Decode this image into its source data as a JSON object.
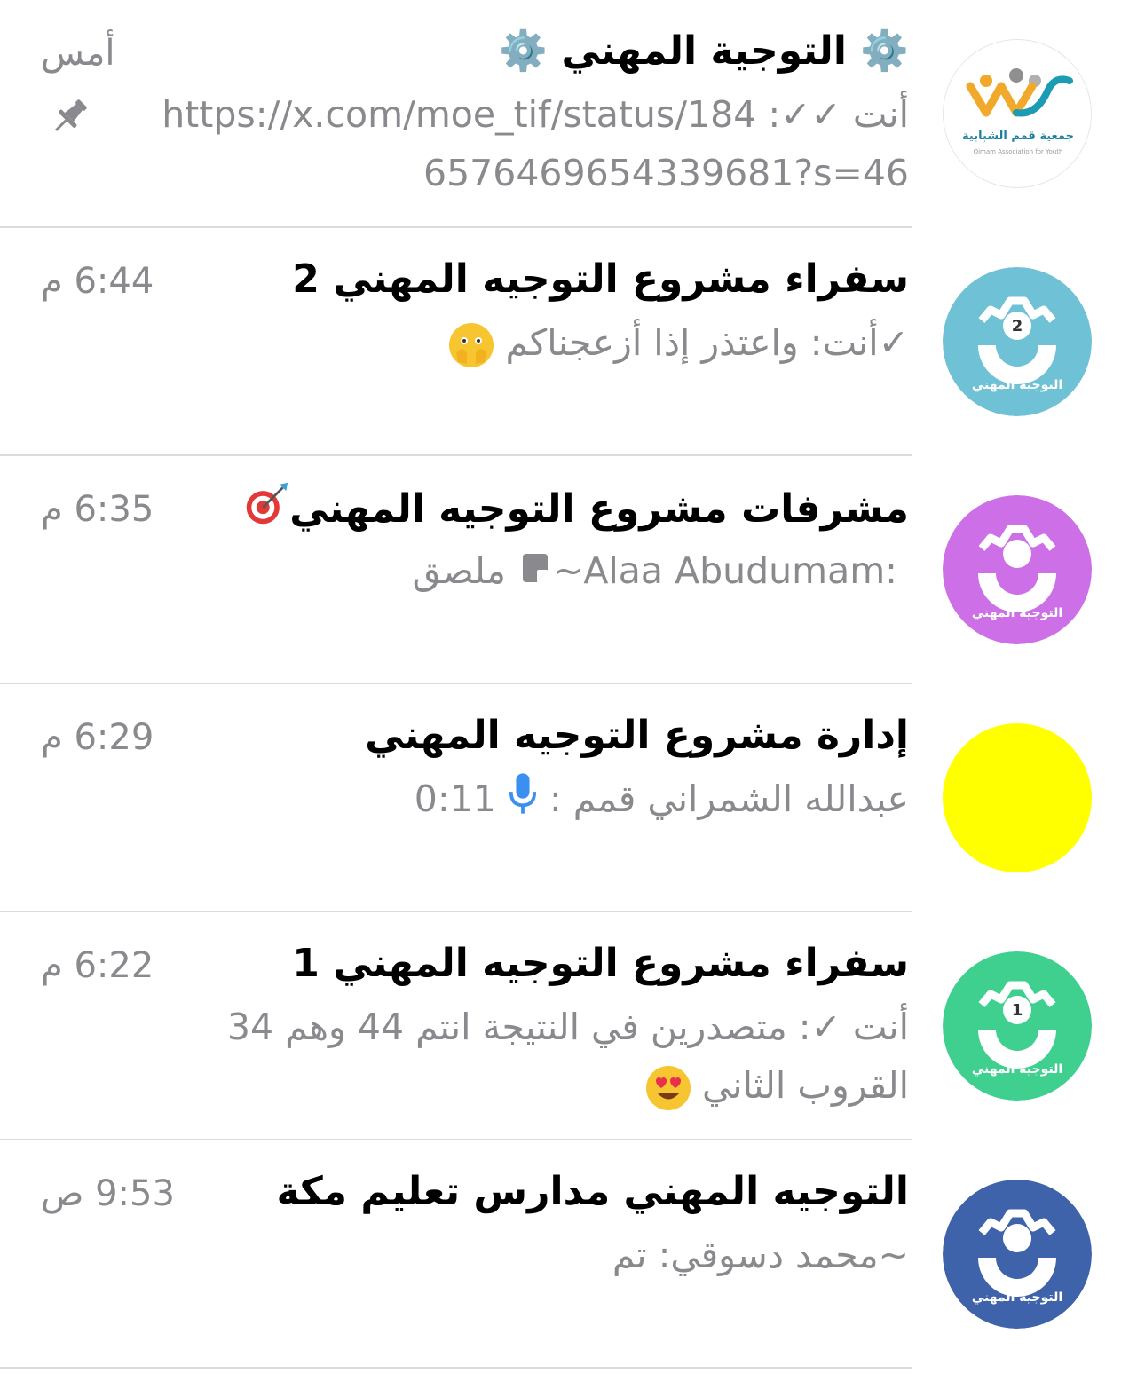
{
  "chats": [
    {
      "title": "⚙️ التوجية المهني ⚙️",
      "time": "أمس",
      "preview_sender": "أنت ✓✓: ",
      "preview_text": "https://x.com/moe_tif/status/1846576469654339681?s=46",
      "pinned": true,
      "avatar": {
        "type": "logo",
        "text_ar": "جمعية قمم الشبابية",
        "text_en": "Qimam Association for Youth"
      }
    },
    {
      "title": "سفراء مشروع التوجيه المهني 2",
      "time": "6:44 م",
      "preview_sender": "✓أنت: ",
      "preview_text": "واعتذر إذا أزعجناكم",
      "preview_emoji": "face-with-open-eyes-and-hand-over-mouth",
      "avatar": {
        "type": "gear",
        "color": "#6fc1d6",
        "badge": "2",
        "label": "التوجيه المهني"
      }
    },
    {
      "title": "مشرفات مشروع التوجيه المهني",
      "title_emoji": "direct-hit",
      "time": "6:35 م",
      "preview_sender": "~Alaa Abudumam: ",
      "preview_text": "ملصق",
      "preview_icon": "sticker-icon",
      "avatar": {
        "type": "gear",
        "color": "#cd6fe6",
        "badge": "",
        "label": "التوجيه المهني"
      }
    },
    {
      "title": "إدارة مشروع التوجيه المهني",
      "time": "6:29 م",
      "preview_sender": "عبدالله الشمراني قمم : ",
      "preview_text": "0:11",
      "preview_icon": "microphone-icon",
      "avatar": {
        "type": "solid",
        "color": "#ffff00"
      }
    },
    {
      "title": "سفراء مشروع التوجيه المهني 1",
      "time": "6:22 م",
      "preview_sender": "أنت ✓: ",
      "preview_text": "متصدرين في النتيجة  انتم 44  وهم 34 القروب الثاني",
      "preview_emoji": "smiling-face-with-heart-eyes",
      "avatar": {
        "type": "gear",
        "color": "#3fcf8e",
        "badge": "1",
        "label": "التوجيه المهني"
      }
    },
    {
      "title": "التوجيه المهني مدارس تعليم مكة",
      "time": "9:53 ص",
      "preview_sender": "~محمد دسوقي: ",
      "preview_text": "تم",
      "avatar": {
        "type": "gear",
        "color": "#3f63aa",
        "badge": "",
        "label": "التوجيه المهني"
      }
    }
  ],
  "colors": {
    "secondary_text": "#8a8a8e",
    "divider": "#dcdcdc",
    "mic_blue": "#3b8ff0"
  }
}
